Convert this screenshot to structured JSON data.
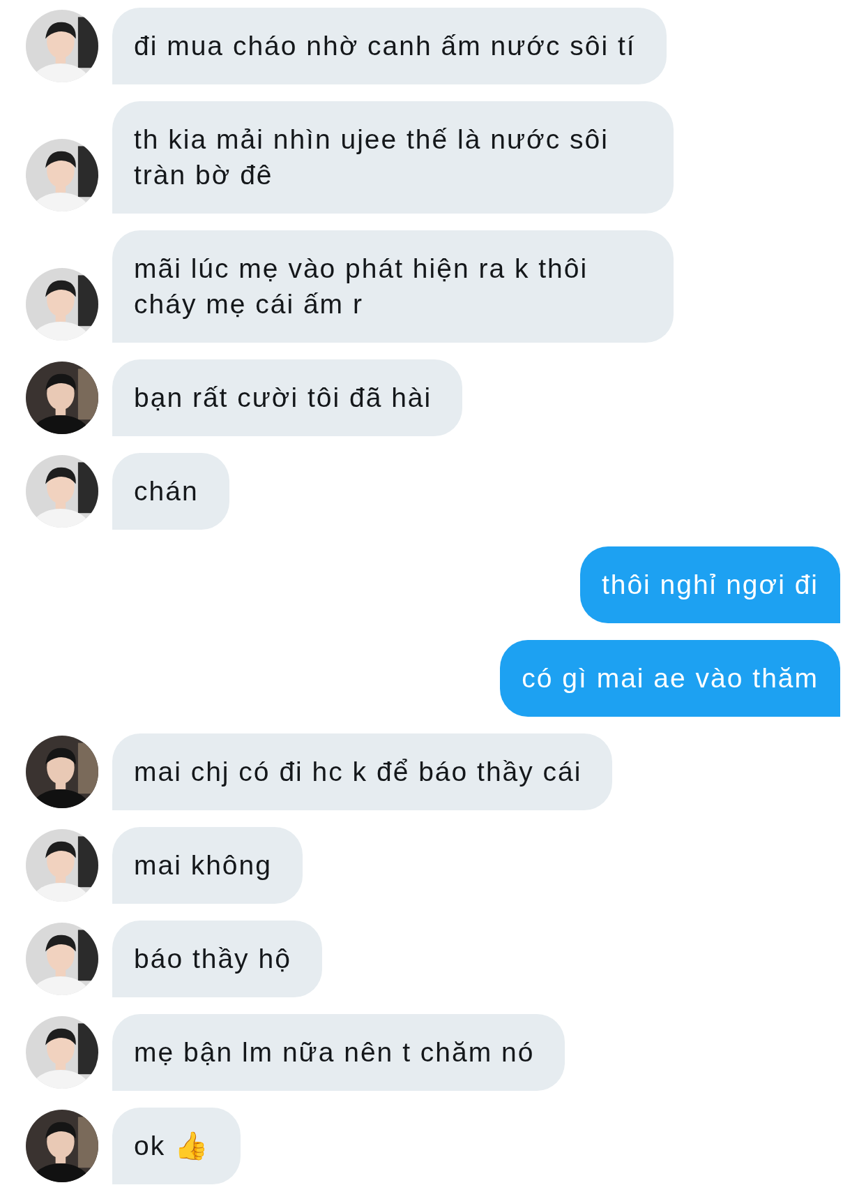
{
  "messages": [
    {
      "kind": "received",
      "avatar": {
        "kind": "light"
      },
      "text": "đi mua cháo nhờ canh ấm nước sôi tí"
    },
    {
      "kind": "received",
      "avatar": {
        "kind": "light"
      },
      "text": "th kia mải nhìn ujee thế là nước sôi tràn bờ đê"
    },
    {
      "kind": "received",
      "avatar": {
        "kind": "light"
      },
      "text": "mãi lúc mẹ vào phát hiện ra k thôi cháy mẹ cái ấm r"
    },
    {
      "kind": "received",
      "avatar": {
        "kind": "dark"
      },
      "text": "bạn rất cười tôi đã hài"
    },
    {
      "kind": "received",
      "avatar": {
        "kind": "light"
      },
      "text": "chán"
    },
    {
      "kind": "sent",
      "text": "thôi nghỉ ngơi đi"
    },
    {
      "kind": "sent",
      "text": "có gì mai ae vào thăm"
    },
    {
      "kind": "received",
      "avatar": {
        "kind": "dark"
      },
      "text": "mai chj có đi hc k để báo thầy cái"
    },
    {
      "kind": "received",
      "avatar": {
        "kind": "light"
      },
      "text": "mai không"
    },
    {
      "kind": "received",
      "avatar": {
        "kind": "light"
      },
      "text": "báo thầy hộ"
    },
    {
      "kind": "received",
      "avatar": {
        "kind": "light"
      },
      "text": "mẹ bận lm nữa nên t chăm nó"
    },
    {
      "kind": "received",
      "avatar": {
        "kind": "dark"
      },
      "text": "ok 👍"
    }
  ]
}
